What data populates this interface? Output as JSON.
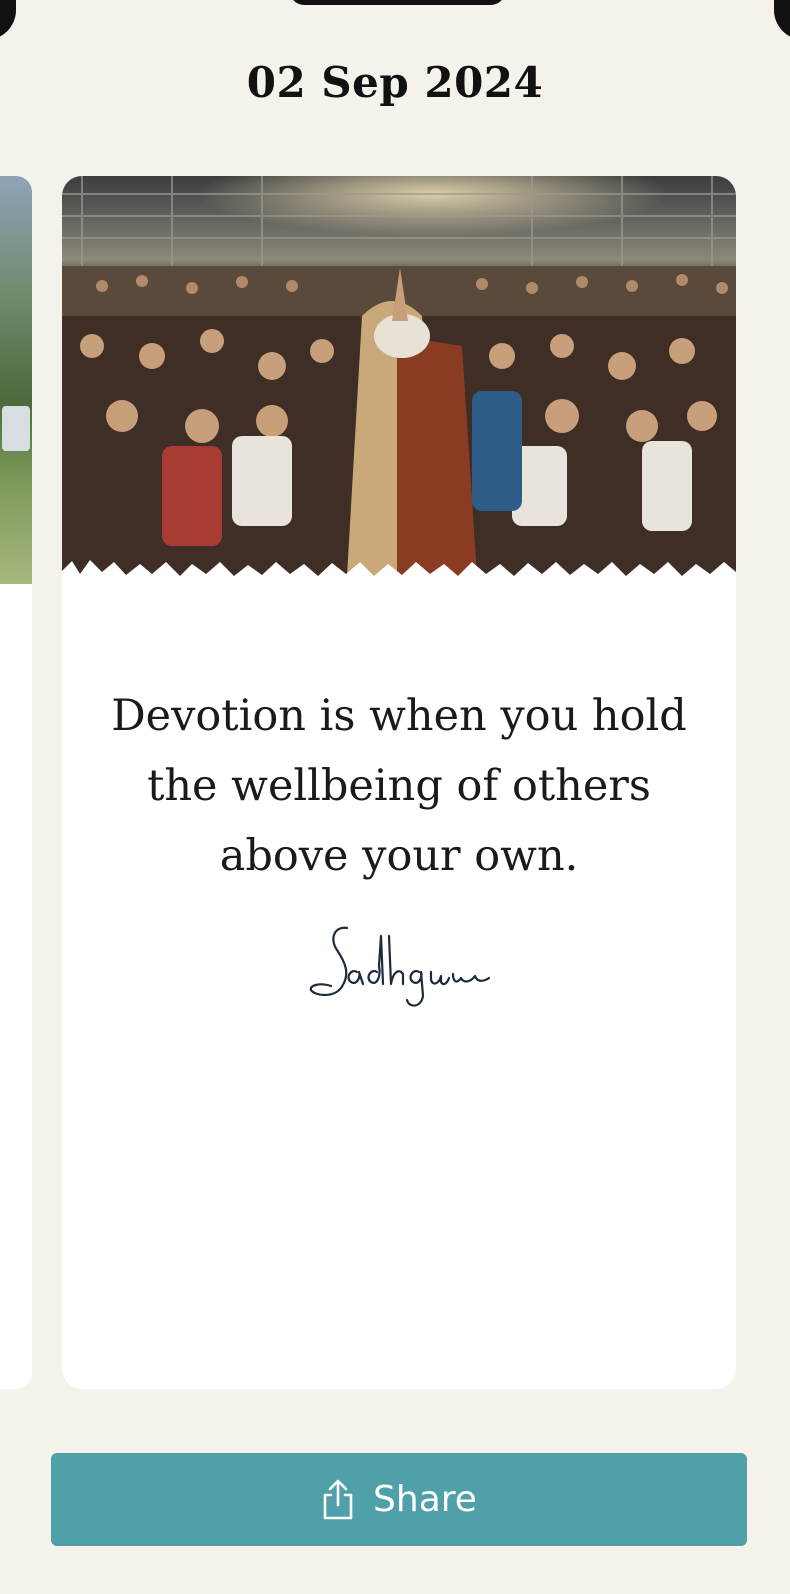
{
  "header": {
    "date": "02 Sep 2024"
  },
  "card": {
    "quote": "Devotion is when you hold the wellbeing of others above your own.",
    "signature": "Sadhguru",
    "photo_icon": "crowd-photo"
  },
  "share": {
    "label": "Share",
    "icon": "share-icon"
  },
  "colors": {
    "background": "#f5f2ec",
    "card": "#ffffff",
    "accent": "#4fa0a8"
  }
}
